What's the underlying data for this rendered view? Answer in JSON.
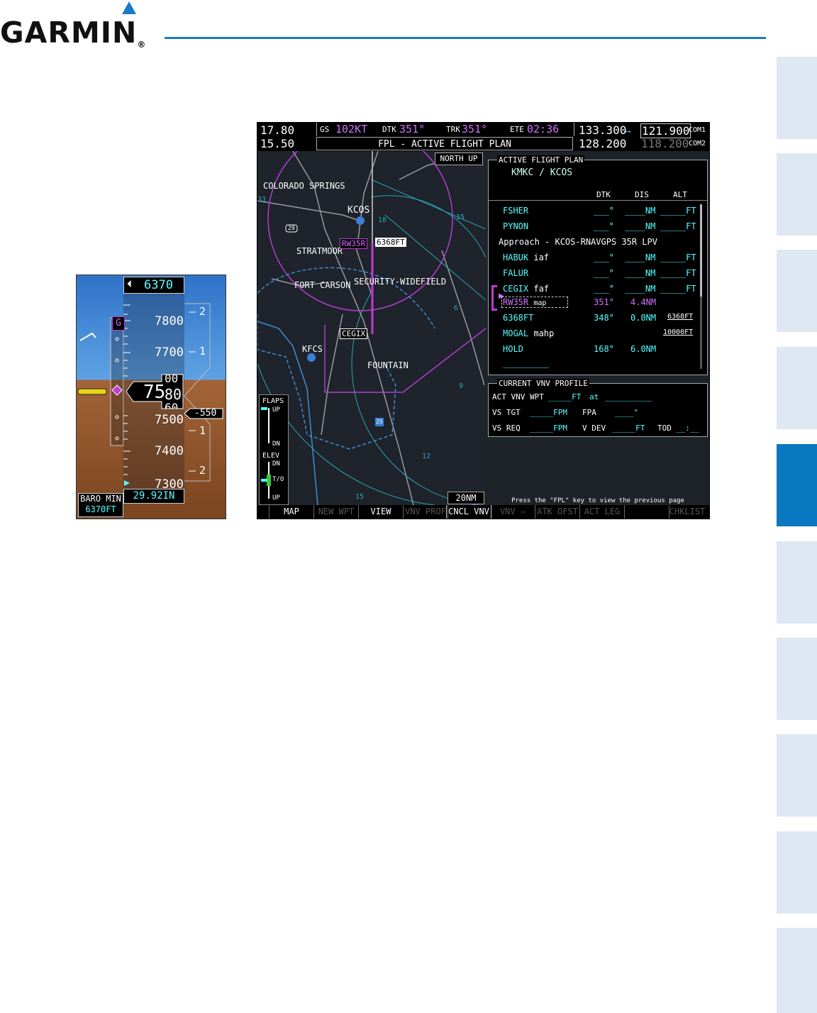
{
  "header": {
    "logo": "GARMIN",
    "trademark": "®"
  },
  "pfd": {
    "selected_altitude": "6370",
    "altitudes": [
      "7800",
      "7700",
      "7500",
      "7400",
      "7300"
    ],
    "current_alt_main": "75",
    "current_alt_digits": "80",
    "current_alt_top": "00",
    "current_alt_bottom": "60",
    "vsi_labels": [
      "2",
      "1",
      "1",
      "2"
    ],
    "vsi_value": "-550",
    "glideslope_label": "G",
    "baro_min_label": "BARO MIN",
    "baro_min_value": "6370FT",
    "baro_setting": "29.92IN"
  },
  "mfd": {
    "nav_active": "17.80",
    "nav_standby": "15.50",
    "gs_label": "GS",
    "gs_value": "102KT",
    "dtk_label": "DTK",
    "dtk_value": "351°",
    "trk_label": "TRK",
    "trk_value": "351°",
    "ete_label": "ETE",
    "ete_value": "02:36",
    "page_title": "FPL - ACTIVE FLIGHT PLAN",
    "com1_active": "133.300",
    "com1_swap": "↔",
    "com1_standby": "121.900",
    "com1_label": "COM1",
    "com2_active": "128.200",
    "com2_standby": "118.200",
    "com2_label": "COM2",
    "map": {
      "orientation": "NORTH UP",
      "range": "20NM",
      "labels": {
        "colorado_springs": "COLORADO SPRINGS",
        "kcos": "KCOS",
        "stratmoor": "STRATMOOR",
        "fort_carson": "FORT CARSON",
        "security": "SECURITY-WIDEFIELD",
        "kfcs": "KFCS",
        "fountain": "FOUNTAIN",
        "cegix": "CEGIX",
        "rw35r": "RW35R",
        "rw_alt": "6368FT",
        "hwy": "29",
        "i25": "25",
        "ring_15a": "15",
        "ring_18": "18",
        "ring_6": "6",
        "ring_9": "9",
        "ring_12": "12",
        "ring_15b": "15",
        "ring_33": "33"
      },
      "flaps": {
        "title": "FLAPS",
        "up": "UP",
        "dn": "DN"
      },
      "elev": {
        "title": "ELEV",
        "dn": "DN",
        "to": "T/O",
        "up": "UP"
      }
    },
    "fpl": {
      "title": "ACTIVE FLIGHT PLAN",
      "route": "KMKC / KCOS",
      "col_dtk": "DTK",
      "col_dis": "DIS",
      "col_alt": "ALT",
      "approach": "Approach - KCOS-RNAVGPS 35R LPV",
      "rows": [
        {
          "wpt": "FSHER",
          "tag": "",
          "dtk": "___°",
          "dis": "____NM",
          "alt": "_____FT"
        },
        {
          "wpt": "PYNON",
          "tag": "",
          "dtk": "___°",
          "dis": "____NM",
          "alt": "_____FT"
        },
        {
          "wpt": "HABUK",
          "tag": "iaf",
          "dtk": "___°",
          "dis": "____NM",
          "alt": "_____FT"
        },
        {
          "wpt": "FALUR",
          "tag": "",
          "dtk": "___°",
          "dis": "____NM",
          "alt": "_____FT"
        },
        {
          "wpt": "CEGIX",
          "tag": "faf",
          "dtk": "___°",
          "dis": "____NM",
          "alt": "_____FT"
        },
        {
          "wpt": "RW35R",
          "tag": "map",
          "dtk": "351°",
          "dis": "4.4NM",
          "alt": ""
        },
        {
          "wpt": "6368FT",
          "tag": "",
          "dtk": "348°",
          "dis": "0.0NM",
          "alt": "6368FT"
        },
        {
          "wpt": "MOGAL",
          "tag": "mahp",
          "dtk": "",
          "dis": "",
          "alt": "10000FT"
        },
        {
          "wpt": "HOLD",
          "tag": "",
          "dtk": "168°",
          "dis": "6.0NM",
          "alt": ""
        },
        {
          "wpt": "_________",
          "tag": "",
          "dtk": "",
          "dis": "",
          "alt": ""
        }
      ]
    },
    "vnv": {
      "title": "CURRENT VNV PROFILE",
      "act_label": "ACT VNV WPT",
      "act_value": "_____FT",
      "at_label": "at",
      "at_value": "__________",
      "vs_tgt_label": "VS TGT",
      "vs_tgt_value": "_____FPM",
      "fpa_label": "FPA",
      "fpa_value": "____°",
      "vs_req_label": "VS REQ",
      "vs_req_value": "_____FPM",
      "vdev_label": "V DEV",
      "vdev_value": "_____FT",
      "tod_label": "TOD",
      "tod_value": "__:__"
    },
    "prompt": "Press the \"FPL\" key to view the previous page",
    "softkeys": [
      "",
      "MAP",
      "NEW WPT",
      "VIEW",
      "VNV PROF",
      "CNCL VNV",
      "VNV ⇨",
      "ATK OFST",
      "ACT LEG",
      "",
      "CHKLIST"
    ]
  }
}
